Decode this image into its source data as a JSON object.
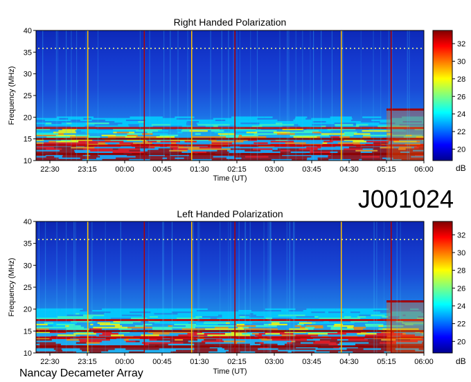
{
  "observation_id": "J001024",
  "instrument": "Nancay Decameter Array",
  "colorbar_unit": "dB",
  "chart_data": [
    {
      "type": "heatmap",
      "title": "Right Handed Polarization",
      "xlabel": "Time (UT)",
      "ylabel": "Frequency (MHz)",
      "x_ticks": [
        "22:30",
        "23:15",
        "00:00",
        "00:45",
        "01:30",
        "02:15",
        "03:00",
        "03:45",
        "04:30",
        "05:15",
        "06:00"
      ],
      "y_ticks": [
        10,
        15,
        20,
        25,
        30,
        35,
        40
      ],
      "ylim": [
        10,
        40
      ],
      "colorbar": {
        "label": "dB",
        "ticks": [
          20,
          22,
          24,
          26,
          28,
          30,
          32
        ],
        "range": [
          18.7,
          33.5
        ],
        "colormap": "jet"
      },
      "strong_bands_mhz": [
        11.5,
        13.5,
        15.0,
        17.5
      ],
      "spike_times": [
        "23:15",
        "00:23",
        "01:20",
        "02:12",
        "04:20",
        "05:20"
      ]
    },
    {
      "type": "heatmap",
      "title": "Left Handed Polarization",
      "xlabel": "Time (UT)",
      "ylabel": "Frequency (MHz)",
      "x_ticks": [
        "22:30",
        "23:15",
        "00:00",
        "00:45",
        "01:30",
        "02:15",
        "03:00",
        "03:45",
        "04:30",
        "05:15",
        "06:00"
      ],
      "y_ticks": [
        10,
        15,
        20,
        25,
        30,
        35,
        40
      ],
      "ylim": [
        10,
        40
      ],
      "colorbar": {
        "label": "dB",
        "ticks": [
          20,
          22,
          24,
          26,
          28,
          30,
          32
        ],
        "range": [
          18.7,
          33.5
        ],
        "colormap": "jet"
      },
      "strong_bands_mhz": [
        11.5,
        13.5,
        15.0,
        17.5
      ],
      "spike_times": [
        "23:15",
        "00:23",
        "01:20",
        "02:12",
        "04:20",
        "05:20"
      ]
    }
  ]
}
